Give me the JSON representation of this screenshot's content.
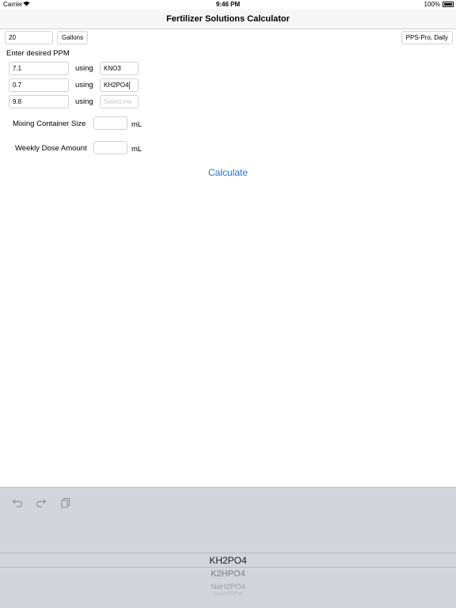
{
  "status_bar": {
    "carrier": "Carrier",
    "time": "9:46 PM",
    "battery": "100%"
  },
  "nav": {
    "title": "Fertilizer Solutions Calculator"
  },
  "volume": {
    "value": "20",
    "unit": "Gallons"
  },
  "method": {
    "label": "PPS-Pro, Daily"
  },
  "ppm_heading": "Enter desired PPM",
  "rows": [
    {
      "ppm": "7.1",
      "using": "using",
      "compound": "KNO3",
      "placeholder": ""
    },
    {
      "ppm": "0.7",
      "using": "using",
      "compound": "KH2PO4",
      "placeholder": ""
    },
    {
      "ppm": "9.8",
      "using": "using",
      "compound": "",
      "placeholder": "Select me"
    }
  ],
  "mixing": {
    "label": "Mixing Container Size",
    "value": "",
    "unit": "mL"
  },
  "weekly": {
    "label": "Weekly Dose Amount",
    "value": "",
    "unit": "mL"
  },
  "calculate_label": "Calculate",
  "keyboard": {
    "icons": [
      "undo-icon",
      "redo-icon",
      "paste-icon"
    ],
    "picker": {
      "selected": "KH2PO4",
      "next": [
        "K2HPO4",
        "NaH2PO4",
        "NaH2PO4"
      ]
    }
  },
  "colors": {
    "accent": "#1a73e8",
    "keyboard_bg": "#d2d5db",
    "nav_bg": "#f7f7f7"
  }
}
